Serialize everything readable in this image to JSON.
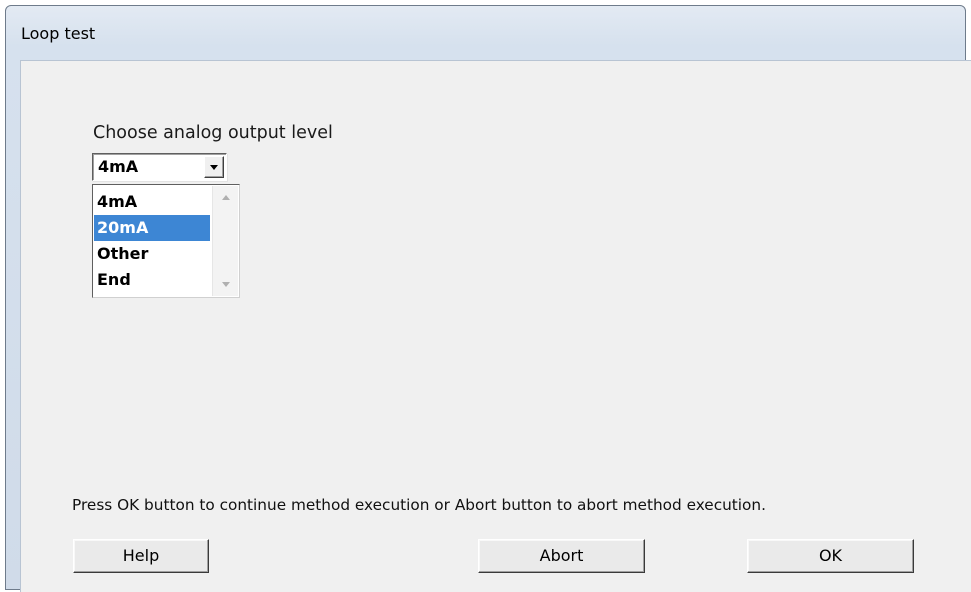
{
  "window": {
    "title": "Loop test"
  },
  "prompt": {
    "label": "Choose analog output level"
  },
  "combo": {
    "selected_value": "4mA"
  },
  "dropdown": {
    "options": [
      "4mA",
      "20mA",
      "Other",
      "End"
    ],
    "highlighted_index": 1
  },
  "message": "Press OK button to continue method execution or Abort button to abort method execution.",
  "buttons": {
    "help": "Help",
    "abort": "Abort",
    "ok": "OK"
  },
  "colors": {
    "selection_highlight": "#3d86d4",
    "dialog_background": "#f0f0f0",
    "title_bar": "#d6e1ee"
  }
}
